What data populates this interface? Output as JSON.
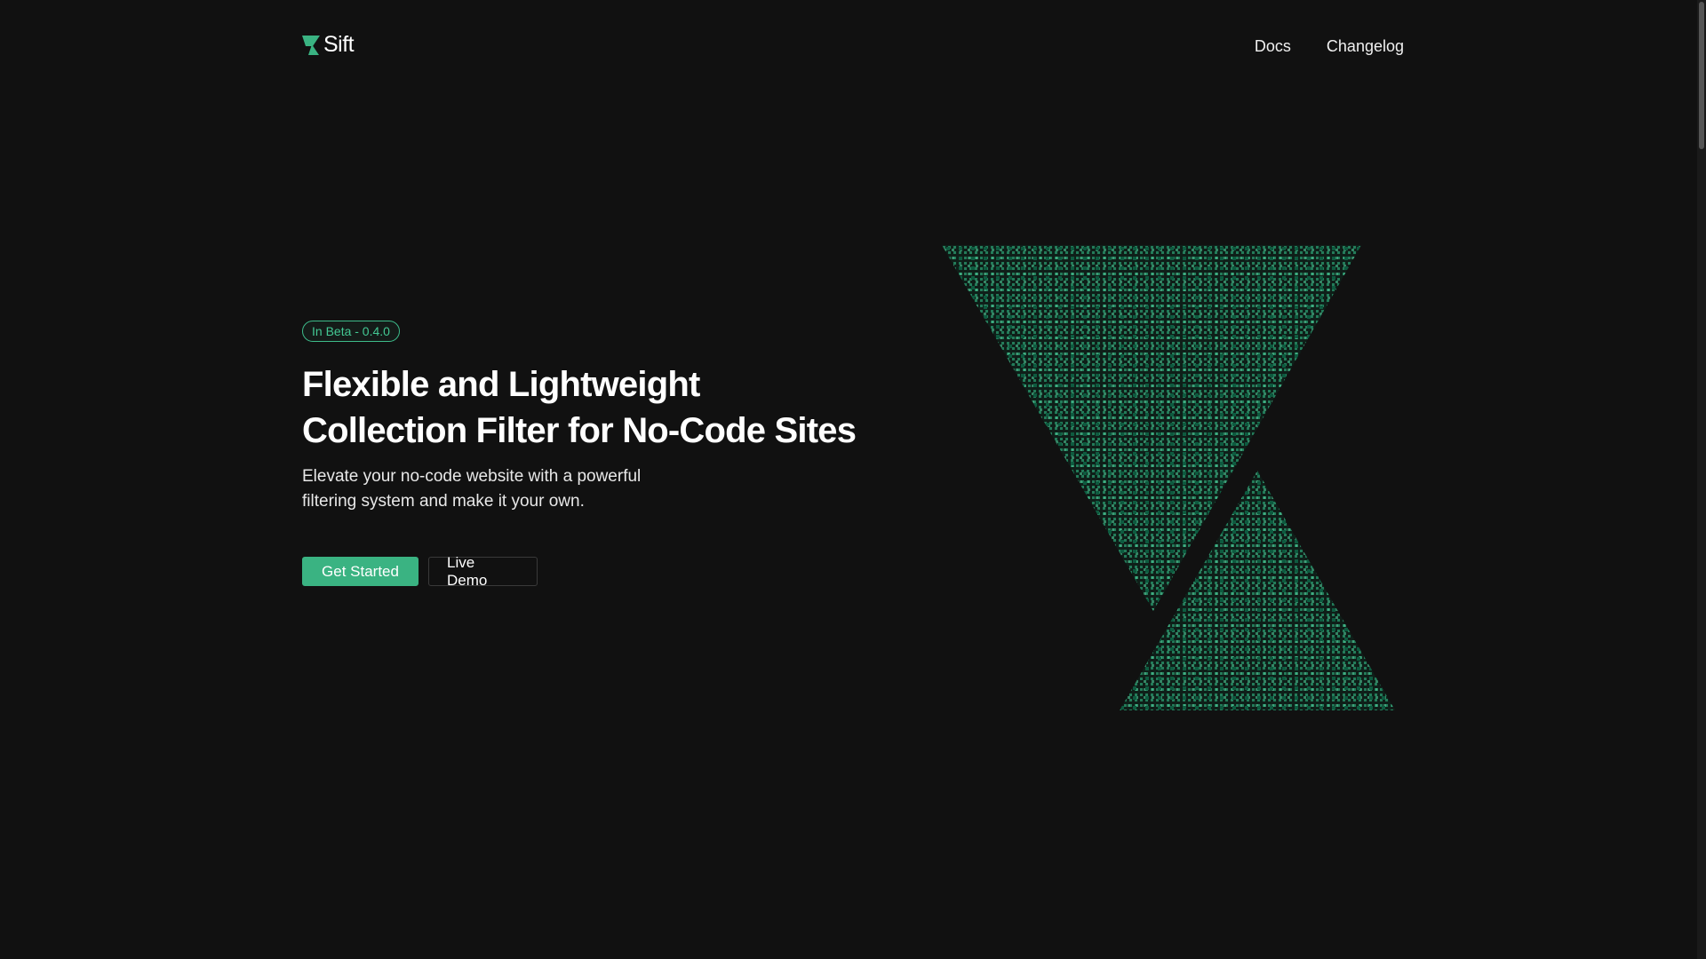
{
  "header": {
    "brand": "Sift",
    "logo_icon": "hourglass-logo-icon",
    "nav": [
      {
        "label": "Docs"
      },
      {
        "label": "Changelog"
      }
    ]
  },
  "hero": {
    "badge": "In Beta - 0.4.0",
    "headline_lines": [
      "Flexible and Lightweight",
      "Collection Filter for No-Code Sites"
    ],
    "subtitle_lines": [
      "Elevate your no-code website with a powerful",
      "filtering system and make it your own."
    ],
    "primary_button": "Get Started",
    "secondary_button": "Live Demo"
  },
  "graphic": {
    "icon": "hourglass-dot-pattern-graphic"
  },
  "colors": {
    "background": "#111111",
    "accent": "#3ab382",
    "text": "#ffffff"
  }
}
